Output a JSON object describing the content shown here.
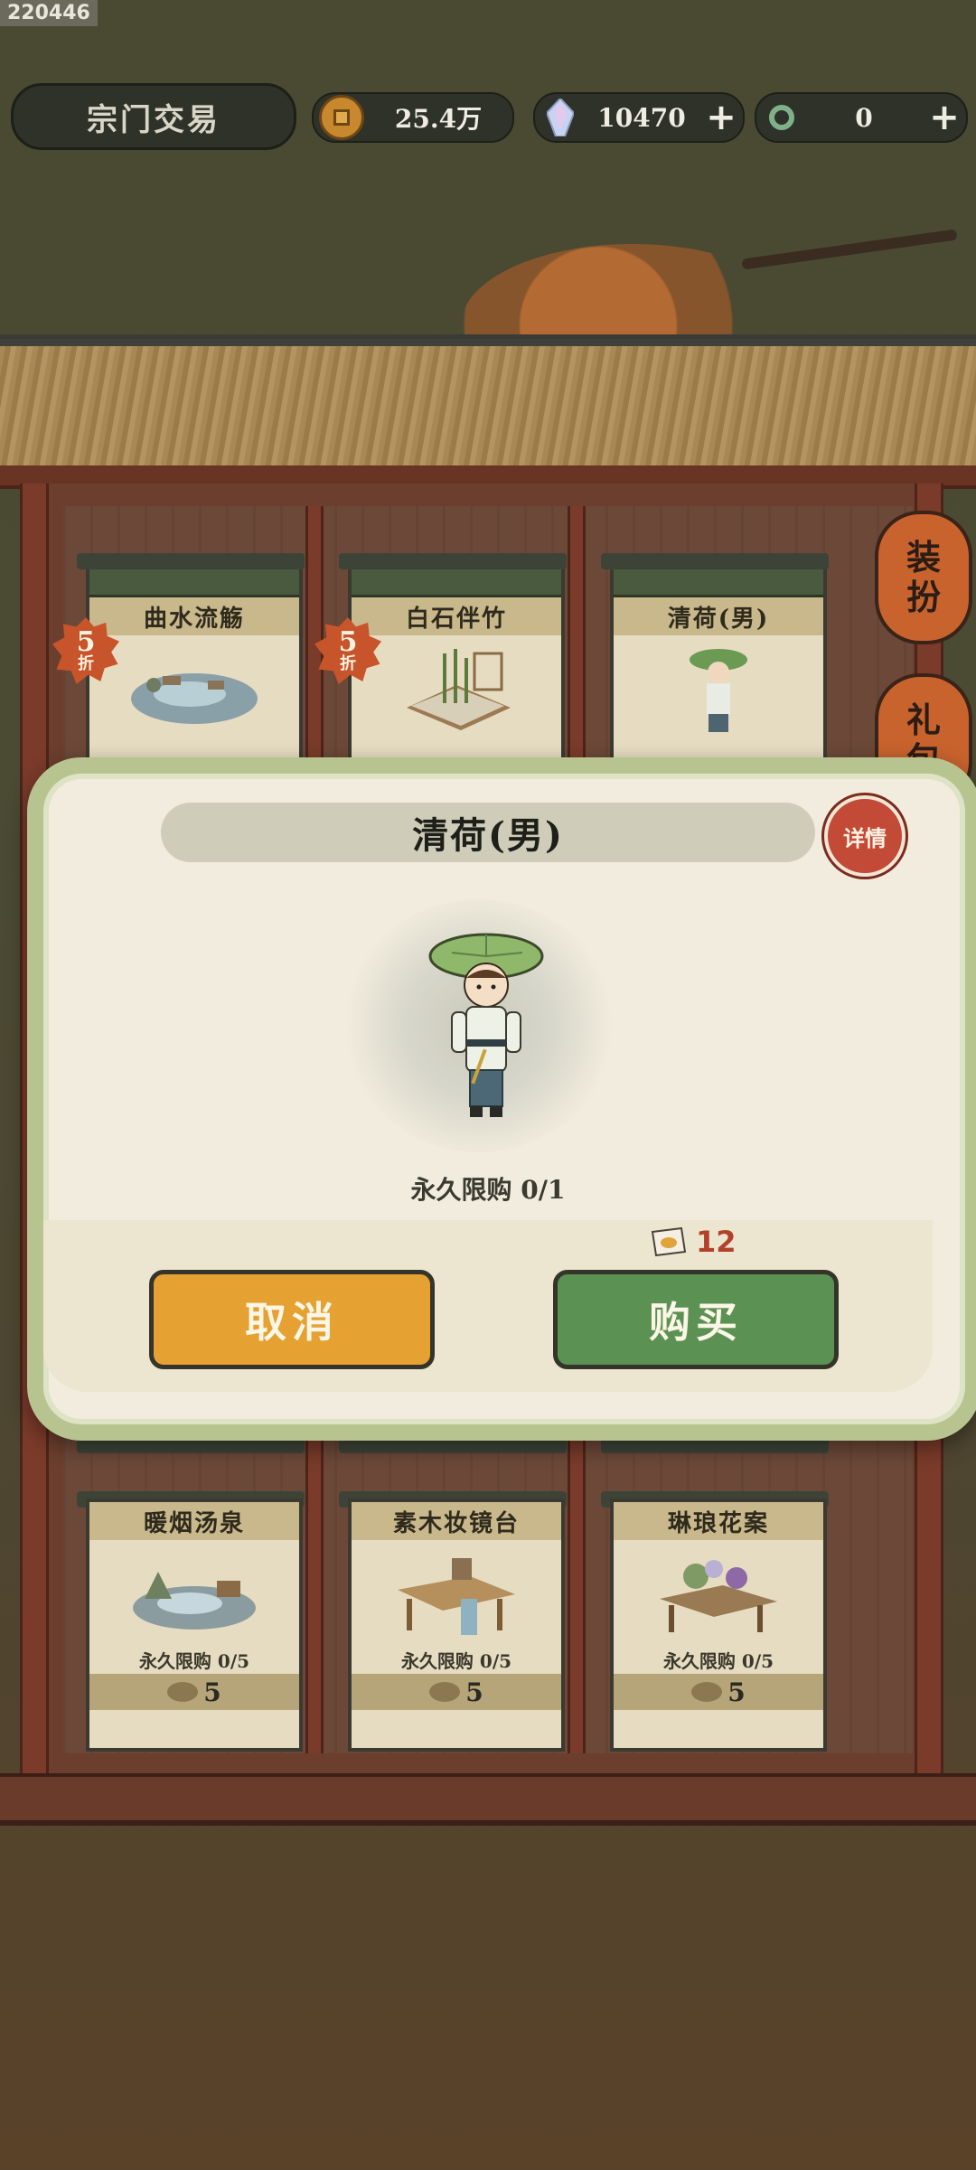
{
  "corner_id": "220446",
  "header": {
    "title": "宗门交易",
    "coins": "25.4万",
    "crystals": "10470",
    "jade": "0",
    "plus": "+"
  },
  "side_menu": [
    {
      "line1": "装",
      "line2": "扮"
    },
    {
      "line1": "礼",
      "line2": "包"
    }
  ],
  "shop_top_row": [
    {
      "name": "曲水流觞",
      "discount": "5",
      "discount_unit": "折"
    },
    {
      "name": "白石伴竹",
      "discount": "5",
      "discount_unit": "折"
    },
    {
      "name": "清荷(男)"
    }
  ],
  "shop_bottom_row": [
    {
      "name": "暖烟汤泉",
      "limit": "永久限购 0/5",
      "price": "5"
    },
    {
      "name": "素木妆镜台",
      "limit": "永久限购 0/5",
      "price": "5"
    },
    {
      "name": "琳琅花案",
      "limit": "永久限购 0/5",
      "price": "5"
    }
  ],
  "modal": {
    "title": "清荷(男)",
    "detail_label": "详情",
    "limit": "永久限购 0/1",
    "price": "12",
    "cancel_label": "取消",
    "buy_label": "购买"
  },
  "icons": {
    "coin": "copper-coin-icon",
    "crystal": "crystal-icon",
    "jade": "jade-ring-icon",
    "ticket": "ticket-icon"
  }
}
